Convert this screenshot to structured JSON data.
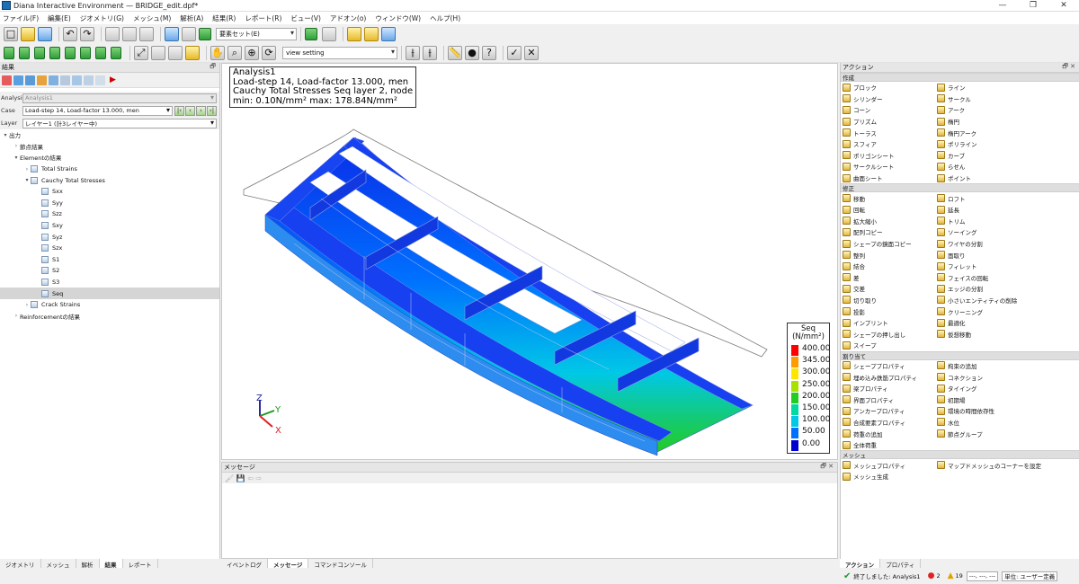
{
  "window": {
    "title": "Diana Interactive Environment — BRIDGE_edit.dpf*",
    "controls": [
      "—",
      "❐",
      "✕"
    ]
  },
  "menu": [
    "ファイル(F)",
    "編集(E)",
    "ジオメトリ(G)",
    "メッシュ(M)",
    "解析(A)",
    "結果(R)",
    "レポート(R)",
    "ビュー(V)",
    "アドオン(o)",
    "ウィンドウ(W)",
    "ヘルプ(H)"
  ],
  "toolbar": {
    "element_set": "要素セット(E)",
    "view_setting": "view setting"
  },
  "results_panel": {
    "title": "結果",
    "analysis_label": "Analysis",
    "analysis_value": "Analysis1",
    "case_label": "Case",
    "case_value": "Load-step 14, Load-factor 13.000, men",
    "layer_label": "Layer",
    "layer_value": "レイヤー1 (計3レイヤー中)"
  },
  "tree": [
    {
      "label": "出力",
      "indent": 0,
      "twisty": "▾",
      "icon": false
    },
    {
      "label": "節点結果",
      "indent": 1,
      "twisty": "›",
      "icon": false
    },
    {
      "label": "Elementの結果",
      "indent": 1,
      "twisty": "▾",
      "icon": false
    },
    {
      "label": "Total Strains",
      "indent": 2,
      "twisty": "›",
      "icon": true
    },
    {
      "label": "Cauchy Total Stresses",
      "indent": 2,
      "twisty": "▾",
      "icon": true
    },
    {
      "label": "Sxx",
      "indent": 3,
      "twisty": "",
      "icon": true
    },
    {
      "label": "Syy",
      "indent": 3,
      "twisty": "",
      "icon": true
    },
    {
      "label": "Szz",
      "indent": 3,
      "twisty": "",
      "icon": true
    },
    {
      "label": "Sxy",
      "indent": 3,
      "twisty": "",
      "icon": true
    },
    {
      "label": "Syz",
      "indent": 3,
      "twisty": "",
      "icon": true
    },
    {
      "label": "Szx",
      "indent": 3,
      "twisty": "",
      "icon": true
    },
    {
      "label": "S1",
      "indent": 3,
      "twisty": "",
      "icon": true
    },
    {
      "label": "S2",
      "indent": 3,
      "twisty": "",
      "icon": true
    },
    {
      "label": "S3",
      "indent": 3,
      "twisty": "",
      "icon": true
    },
    {
      "label": "Seq",
      "indent": 3,
      "twisty": "",
      "icon": true,
      "selected": true
    },
    {
      "label": "Crack Strains",
      "indent": 2,
      "twisty": "›",
      "icon": true
    },
    {
      "label": "Reinforcementの結果",
      "indent": 1,
      "twisty": "›",
      "icon": false
    }
  ],
  "left_tabs": [
    "ジオメトリ",
    "メッシュ",
    "解析",
    "結果",
    "レポート"
  ],
  "left_tab_active": "結果",
  "viewport": {
    "info": [
      "Analysis1",
      "Load-step 14, Load-factor 13.000, men",
      "Cauchy Total Stresses Seq layer 2, node",
      "min:  0.10N/mm² max: 178.84N/mm²"
    ],
    "legend_title": "Seq\n(N/mm²)",
    "legend": [
      {
        "label": "400.00",
        "color": "#ff0000"
      },
      {
        "label": "345.00",
        "color": "#ff9a00"
      },
      {
        "label": "300.00",
        "color": "#ffe600"
      },
      {
        "label": "250.00",
        "color": "#a8e000"
      },
      {
        "label": "200.00",
        "color": "#22cc22"
      },
      {
        "label": "150.00",
        "color": "#00d9a0"
      },
      {
        "label": "100.00",
        "color": "#00c8e6"
      },
      {
        "label": "50.00",
        "color": "#0070ff"
      },
      {
        "label": "0.00",
        "color": "#0000d0"
      }
    ],
    "axes": {
      "x": "X",
      "y": "Y",
      "z": "Z"
    }
  },
  "messages": {
    "title": "メッセージ",
    "tabs": [
      "イベントログ",
      "メッセージ",
      "コマンドコンソール"
    ],
    "tab_active": "メッセージ"
  },
  "actions": {
    "title": "アクション",
    "sections": [
      {
        "title": "作成",
        "items": [
          "ブロック",
          "ライン",
          "シリンダー",
          "サークル",
          "コーン",
          "アーク",
          "プリズム",
          "楕円",
          "トーラス",
          "楕円アーク",
          "スフィア",
          "ポリライン",
          "ポリゴンシート",
          "カーブ",
          "サークルシート",
          "らせん",
          "曲面シート",
          "ポイント"
        ]
      },
      {
        "title": "修正",
        "items": [
          "移動",
          "ロフト",
          "回転",
          "延長",
          "拡大縮小",
          "トリム",
          "配列コピー",
          "ソーイング",
          "シェープの鏡面コピー",
          "ワイヤの分割",
          "整列",
          "面取り",
          "結合",
          "フィレット",
          "差",
          "フェイスの回転",
          "交差",
          "エッジの分割",
          "切り取り",
          "小さいエンティティの削除",
          "投影",
          "クリーニング",
          "インプリント",
          "最適化",
          "シェープの押し出し",
          "仮想移動",
          "スイープ"
        ]
      },
      {
        "title": "割り当て",
        "items": [
          "シェーププロパティ",
          "拘束の追加",
          "埋め込み鉄筋プロパティ",
          "コネクション",
          "梁プロパティ",
          "タイイング",
          "界面プロパティ",
          "初期場",
          "アンカープロパティ",
          "環境の時間依存性",
          "合成要素プロパティ",
          "水位",
          "荷重の追加",
          "節点グループ",
          "全体荷重"
        ]
      },
      {
        "title": "メッシュ",
        "items": [
          "メッシュプロパティ",
          "マップドメッシュのコーナーを設定",
          "メッシュ生成"
        ]
      }
    ],
    "tabs": [
      "アクション",
      "プロパティ"
    ],
    "tab_active": "アクション"
  },
  "status": {
    "text": "終了しました: Analysis1",
    "errors": "2",
    "warnings": "19",
    "coords": "---, ---, ---",
    "units": "単位: ユーザー定義"
  }
}
